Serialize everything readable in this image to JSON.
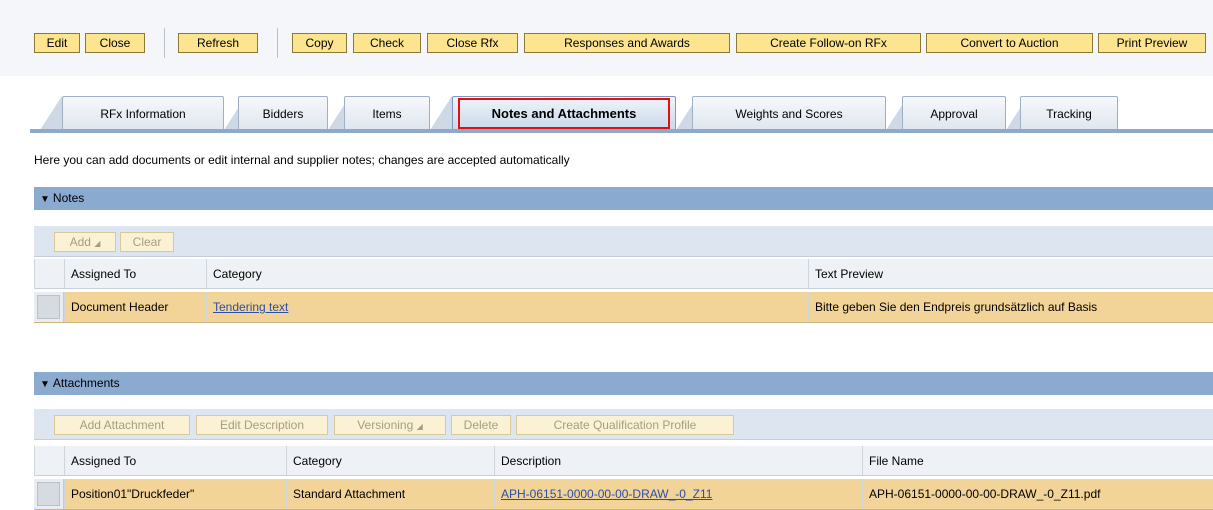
{
  "toolbar": {
    "edit": "Edit",
    "close": "Close",
    "refresh": "Refresh",
    "copy": "Copy",
    "check": "Check",
    "close_rfx": "Close Rfx",
    "responses_awards": "Responses and Awards",
    "create_followon": "Create Follow-on RFx",
    "convert_auction": "Convert to Auction",
    "print_preview": "Print Preview"
  },
  "tabs": [
    {
      "label": "RFx Information"
    },
    {
      "label": "Bidders"
    },
    {
      "label": "Items"
    },
    {
      "label": "Notes and Attachments",
      "active": true
    },
    {
      "label": "Weights and Scores"
    },
    {
      "label": "Approval"
    },
    {
      "label": "Tracking"
    }
  ],
  "info_text": "Here you can add documents or edit internal and supplier notes; changes are accepted automatically",
  "notes": {
    "title": "Notes",
    "buttons": {
      "add": "Add",
      "clear": "Clear"
    },
    "columns": [
      "Assigned To",
      "Category",
      "Text Preview"
    ],
    "rows": [
      {
        "assigned_to": "Document Header",
        "category": "Tendering text",
        "text_preview": "Bitte geben Sie den Endpreis grundsätzlich auf Basis"
      }
    ]
  },
  "attachments": {
    "title": "Attachments",
    "buttons": {
      "add_attachment": "Add Attachment",
      "edit_description": "Edit Description",
      "versioning": "Versioning",
      "delete": "Delete",
      "create_qualification": "Create Qualification Profile"
    },
    "columns": [
      "Assigned To",
      "Category",
      "Description",
      "File Name"
    ],
    "rows": [
      {
        "assigned_to": "Position01\"Druckfeder\"",
        "category": "Standard Attachment",
        "description": "APH-06151-0000-00-00-DRAW_-0_Z11",
        "file_name": "APH-06151-0000-00-00-DRAW_-0_Z11.pdf"
      }
    ]
  },
  "colors": {
    "toolbar_button": "#fde590",
    "section_header": "#8aaad0",
    "selected_row": "#f2d398",
    "highlight_box": "#e01010",
    "link": "#2a4fa8"
  }
}
